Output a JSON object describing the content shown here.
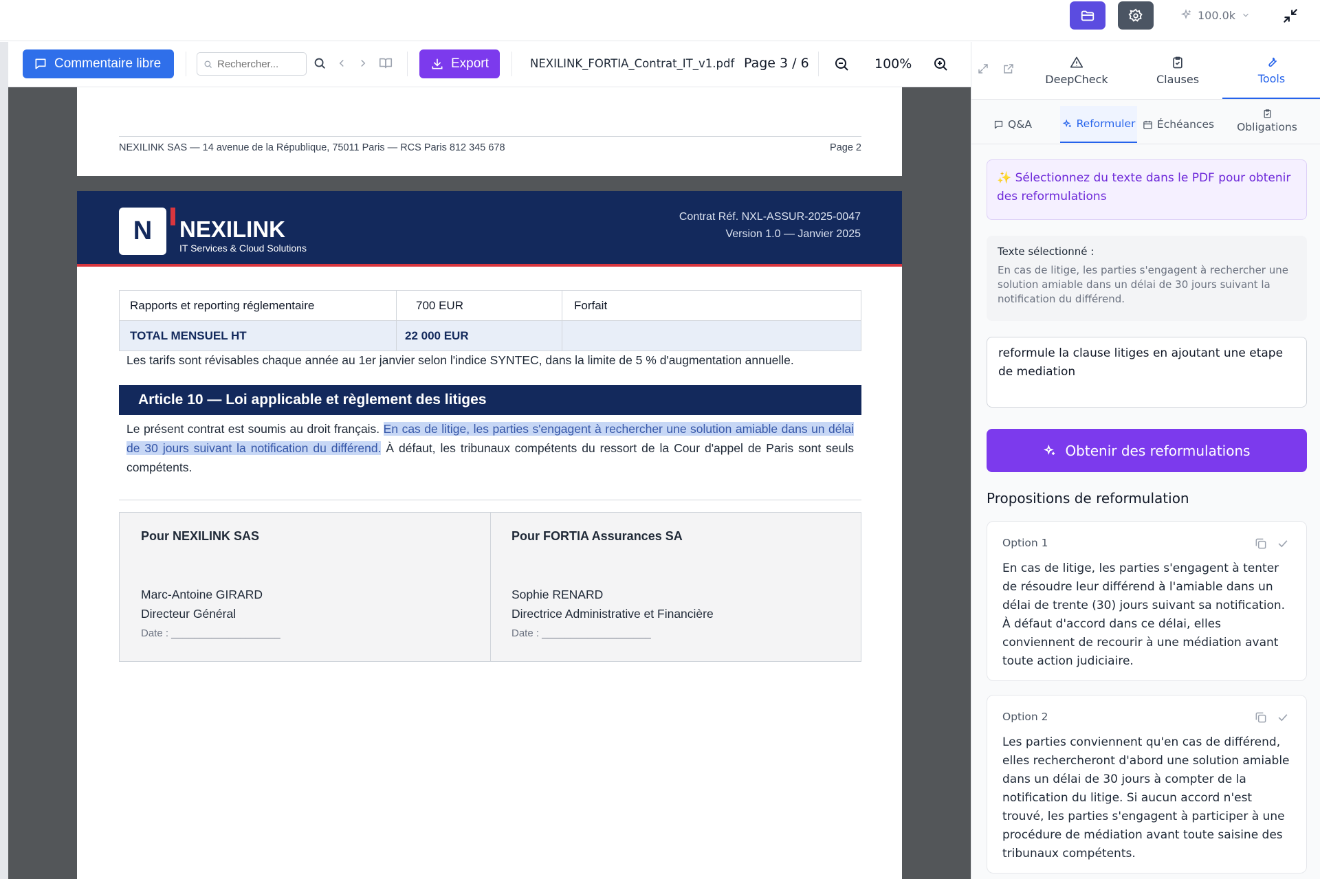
{
  "topbar": {
    "tokens": "100.0k",
    "icons": [
      "folder-icon",
      "settings-icon",
      "sparkle-icon",
      "chevron-down-icon",
      "minimize-icon"
    ]
  },
  "toolbar": {
    "comment_label": "Commentaire libre",
    "search_placeholder": "Rechercher...",
    "export_label": "Export",
    "filename": "NEXILINK_FORTIA_Contrat_IT_v1.pdf",
    "page_indicator": "Page 3 / 6",
    "zoom": "100%"
  },
  "doc": {
    "prev_footer_left": "NEXILINK SAS — 14 avenue de la République, 75011 Paris — RCS Paris 812 345 678",
    "prev_footer_right": "Page 2",
    "logo_letter": "N",
    "brand": "NEXILINK",
    "tagline": "IT Services & Cloud Solutions",
    "contract_ref": "Contrat Réf. NXL-ASSUR-2025-0047",
    "version": "Version 1.0 — Janvier 2025",
    "table": [
      [
        "Rapports et reporting réglementaire",
        "700 EUR",
        "Forfait"
      ],
      [
        "TOTAL MENSUEL HT",
        "22 000 EUR",
        ""
      ]
    ],
    "tarifs_note": "Les tarifs sont révisables chaque année au 1er janvier selon l'indice SYNTEC, dans la limite de 5 % d'augmentation annuelle.",
    "article_title": "Article 10 — Loi applicable et règlement des litiges",
    "para_start": "Le présent contrat est soumis au droit français. ",
    "para_highlight": "En cas de litige, les parties s'engagent à rechercher une solution amiable dans un délai de 30 jours suivant la notification du différend.",
    "para_end": " À défaut, les tribunaux compétents du ressort de la Cour d'appel de Paris sont seuls compétents.",
    "sig_left": {
      "title": "Pour NEXILINK SAS",
      "name": "Marc-Antoine GIRARD",
      "role": "Directeur Général",
      "date": "Date : ___________________"
    },
    "sig_right": {
      "title": "Pour FORTIA Assurances SA",
      "name": "Sophie RENARD",
      "role": "Directrice Administrative et Financière",
      "date": "Date : ___________________"
    }
  },
  "panel": {
    "tabs": [
      "DeepCheck",
      "Clauses",
      "Tools"
    ],
    "active_tab": "Tools",
    "subtabs": [
      "Q&A",
      "Reformuler",
      "Échéances",
      "Obligations"
    ],
    "active_subtab": "Reformuler",
    "hint_icon": "✨",
    "hint": "Sélectionnez du texte dans le PDF pour obtenir des reformulations",
    "selected_label": "Texte sélectionné :",
    "selected_text": "En cas de litige, les parties s'engagent à rechercher une solution amiable dans un délai de 30 jours suivant la notification du différend.",
    "instruction": "reformule la clause litiges en ajoutant une etape de mediation",
    "submit_label": "Obtenir des reformulations",
    "proposals_title": "Propositions de reformulation",
    "options": [
      {
        "label": "Option 1",
        "text": "En cas de litige, les parties s'engagent à tenter de résoudre leur différend à l'amiable dans un délai de trente (30) jours suivant sa notification. À défaut d'accord dans ce délai, elles conviennent de recourir à une médiation avant toute action judiciaire."
      },
      {
        "label": "Option 2",
        "text": "Les parties conviennent qu'en cas de différend, elles rechercheront d'abord une solution amiable dans un délai de 30 jours à compter de la notification du litige. Si aucun accord n'est trouvé, les parties s'engagent à participer à une procédure de médiation avant toute saisine des tribunaux compétents."
      }
    ]
  },
  "colors": {
    "accent": "#5b4ce0",
    "purple": "#7c3aed",
    "navy": "#13295c",
    "comment_blue": "#2f6fea",
    "active_tab": "#2563eb",
    "highlight": "#c7d7f5",
    "red_stripe": "#d9363e"
  }
}
